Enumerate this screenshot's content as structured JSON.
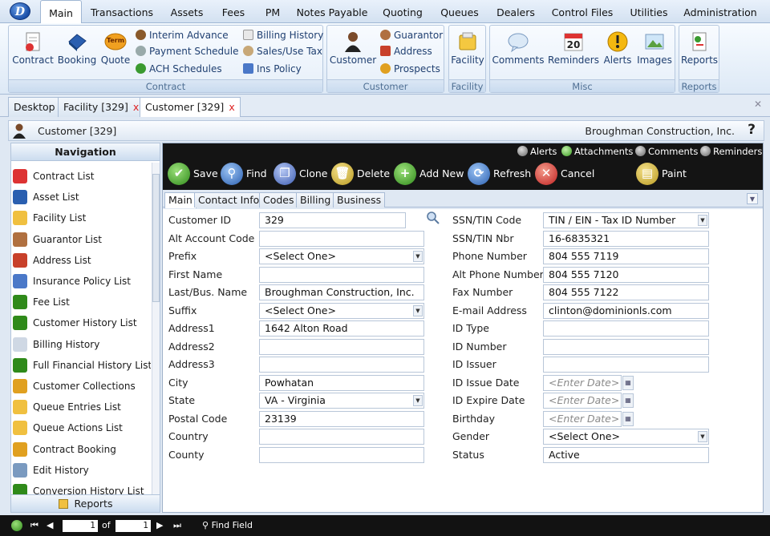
{
  "menubar": {
    "logo_letter": "D",
    "items": [
      "Main",
      "Transactions",
      "Assets",
      "Fees",
      "PM",
      "Notes Payable",
      "Quoting",
      "Queues",
      "Dealers",
      "Control Files",
      "Utilities",
      "Administration"
    ]
  },
  "ribbon": {
    "contract_group": {
      "title": "Contract",
      "big": [
        "Contract",
        "Booking",
        "Quote"
      ],
      "quote_badge": "Term",
      "small": [
        "Interim Advance",
        "Payment Schedule",
        "ACH Schedules",
        "Billing History",
        "Sales/Use Tax",
        "Ins Policy"
      ]
    },
    "customer_group": {
      "title": "Customer",
      "big": "Customer",
      "small": [
        "Guarantor",
        "Address",
        "Prospects"
      ]
    },
    "facility_group": {
      "title": "Facility",
      "big": "Facility"
    },
    "misc_group": {
      "title": "Misc",
      "big": [
        "Comments",
        "Reminders",
        "Alerts",
        "Images"
      ],
      "reminders_badge": "20"
    },
    "reports_group": {
      "title": "Reports",
      "big": "Reports"
    }
  },
  "doctabs": [
    {
      "label": "Desktop",
      "closable": false
    },
    {
      "label": "Facility [329]",
      "closable": true
    },
    {
      "label": "Customer [329]",
      "closable": true,
      "active": true
    }
  ],
  "doctabs_close_glyph": "x",
  "customer_header": {
    "title": "Customer [329]",
    "company": "Broughman Construction, Inc.",
    "help": "?"
  },
  "navigation": {
    "title": "Navigation",
    "items": [
      "Contract List",
      "Asset List",
      "Facility List",
      "Guarantor List",
      "Address List",
      "Insurance Policy List",
      "Fee List",
      "Customer History List",
      "Billing History",
      "Full Financial History List",
      "Customer Collections",
      "Queue Entries List",
      "Queue Actions List",
      "Contract Booking",
      "Edit History",
      "Conversion History List"
    ],
    "footer": "Reports"
  },
  "toolbar": {
    "toggles": [
      {
        "label": "Alerts",
        "checked": false
      },
      {
        "label": "Attachments",
        "checked": true
      },
      {
        "label": "Comments",
        "checked": false
      },
      {
        "label": "Reminders",
        "checked": false
      }
    ],
    "buttons": [
      "Save",
      "Find",
      "Clone",
      "Delete",
      "Add New",
      "Refresh",
      "Cancel",
      "Paint"
    ]
  },
  "form_tabs": [
    "Main",
    "Contact Info",
    "Codes",
    "Billing",
    "Business"
  ],
  "form": {
    "left": [
      {
        "label": "Customer ID",
        "value": "329",
        "type": "text"
      },
      {
        "label": "Alt Account Code",
        "value": "",
        "type": "text"
      },
      {
        "label": "Prefix",
        "value": "<Select One>",
        "type": "select"
      },
      {
        "label": "First Name",
        "value": "",
        "type": "text"
      },
      {
        "label": "Last/Bus. Name",
        "value": "Broughman Construction, Inc.",
        "type": "text"
      },
      {
        "label": "Suffix",
        "value": "<Select One>",
        "type": "select"
      },
      {
        "label": "Address1",
        "value": "1642 Alton Road",
        "type": "text"
      },
      {
        "label": "Address2",
        "value": "",
        "type": "text"
      },
      {
        "label": "Address3",
        "value": "",
        "type": "text"
      },
      {
        "label": "City",
        "value": "Powhatan",
        "type": "text"
      },
      {
        "label": "State",
        "value": "VA - Virginia",
        "type": "select"
      },
      {
        "label": "Postal Code",
        "value": "23139",
        "type": "text"
      },
      {
        "label": "Country",
        "value": "",
        "type": "text"
      },
      {
        "label": "County",
        "value": "",
        "type": "text"
      }
    ],
    "right": [
      {
        "label": "SSN/TIN Code",
        "value": "TIN / EIN - Tax ID Number",
        "type": "select"
      },
      {
        "label": "SSN/TIN Nbr",
        "value": "16-6835321",
        "type": "text"
      },
      {
        "label": "Phone Number",
        "value": "804 555 7119",
        "type": "text"
      },
      {
        "label": "Alt Phone Number",
        "value": "804 555 7120",
        "type": "text"
      },
      {
        "label": "Fax Number",
        "value": "804 555 7122",
        "type": "text"
      },
      {
        "label": "E-mail Address",
        "value": "clinton@dominionls.com",
        "type": "text"
      },
      {
        "label": "ID Type",
        "value": "",
        "type": "text"
      },
      {
        "label": "ID Number",
        "value": "",
        "type": "text"
      },
      {
        "label": "ID Issuer",
        "value": "",
        "type": "text"
      },
      {
        "label": "ID Issue Date",
        "value": "<Enter Date>",
        "type": "date"
      },
      {
        "label": "ID Expire Date",
        "value": "<Enter Date>",
        "type": "date"
      },
      {
        "label": "Birthday",
        "value": "<Enter Date>",
        "type": "date"
      },
      {
        "label": "Gender",
        "value": "<Select One>",
        "type": "select"
      },
      {
        "label": "Status",
        "value": "Active",
        "type": "text"
      }
    ]
  },
  "pager": {
    "current": "1",
    "of_label": "of",
    "total": "1",
    "find_label": "Find Field"
  },
  "colors": {
    "toolbar_bg": "#141414",
    "accent": "#1f3f70",
    "close_red": "#d22222"
  }
}
